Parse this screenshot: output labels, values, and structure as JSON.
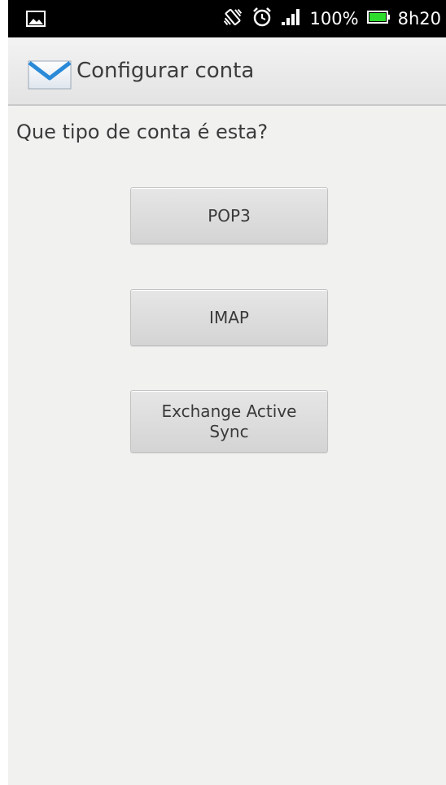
{
  "status_bar": {
    "battery_percent": "100%",
    "time": "8h20",
    "icons": [
      "image-icon",
      "vibrate-icon",
      "alarm-icon",
      "signal-icon",
      "battery-icon"
    ],
    "battery_color": "#2edc2e"
  },
  "action_bar": {
    "title": "Configurar conta",
    "icon": "mail-icon"
  },
  "main": {
    "question": "Que tipo de conta é esta?",
    "options": [
      {
        "label": "POP3"
      },
      {
        "label": "IMAP"
      },
      {
        "label_line1": "Exchange Active",
        "label_line2": "Sync"
      }
    ]
  }
}
